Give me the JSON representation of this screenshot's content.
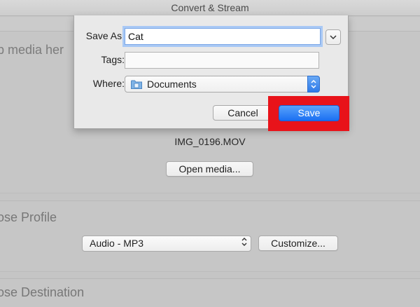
{
  "window": {
    "title": "Convert & Stream"
  },
  "background": {
    "drop_label": "p media her",
    "file_name": "IMG_0196.MOV",
    "open_media_label": "Open media...",
    "profile_label": "ose Profile",
    "profile_value": "Audio - MP3",
    "customize_label": "Customize...",
    "destination_label": "ose Destination"
  },
  "save_dialog": {
    "save_as_label": "Save As:",
    "save_as_value": "Cat",
    "tags_label": "Tags:",
    "tags_value": "",
    "where_label": "Where:",
    "where_value": "Documents",
    "cancel_label": "Cancel",
    "save_label": "Save"
  },
  "colors": {
    "highlight": "#e8131a",
    "accent": "#1a6ff2"
  },
  "icons": {
    "folder": "documents-folder-icon",
    "expand": "chevron-down-icon",
    "where_arrows": "updown-chevron-icon"
  }
}
